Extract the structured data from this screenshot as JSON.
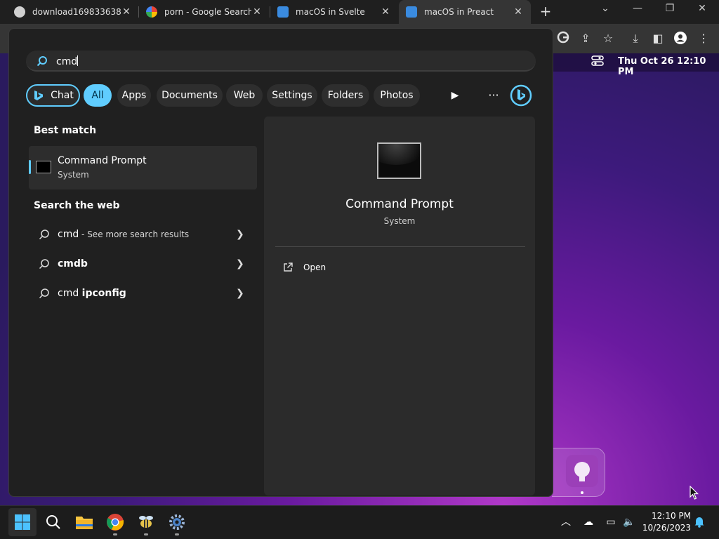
{
  "browser": {
    "tabs": [
      {
        "title": "download169833638…",
        "active": false
      },
      {
        "title": "porn - Google Search",
        "active": false
      },
      {
        "title": "macOS in Svelte",
        "active": false
      },
      {
        "title": "macOS in Preact",
        "active": true
      }
    ],
    "new_tab_label": "+",
    "toolbar_icons": [
      "google-icon",
      "share-icon",
      "star-icon",
      "download-icon",
      "sidepanel-icon",
      "profile-icon",
      "menu-icon"
    ]
  },
  "desktop": {
    "menubar_datetime": "Thu Oct 26  12:10 PM"
  },
  "search": {
    "query": "cmd",
    "filters": [
      "Chat",
      "All",
      "Apps",
      "Documents",
      "Web",
      "Settings",
      "Folders",
      "Photos"
    ],
    "active_filter": "All",
    "best_match_title": "Best match",
    "best_match": {
      "name": "Command Prompt",
      "subtitle": "System"
    },
    "web_title": "Search the web",
    "web_results": [
      {
        "bold": "cmd",
        "suffix": " - See more search results"
      },
      {
        "bold": "cmdb",
        "suffix": ""
      },
      {
        "prefix": "cmd ",
        "bold": "ipconfig"
      }
    ],
    "detail": {
      "name": "Command Prompt",
      "subtitle": "System",
      "action_open": "Open"
    }
  },
  "taskbar": {
    "apps": [
      "start-icon",
      "search-icon",
      "file-explorer-icon",
      "chrome-icon",
      "bee-app-icon",
      "settings-icon"
    ],
    "time": "12:10 PM",
    "date": "10/26/2023"
  },
  "colors": {
    "accent": "#60cdff",
    "panel": "#202020"
  }
}
